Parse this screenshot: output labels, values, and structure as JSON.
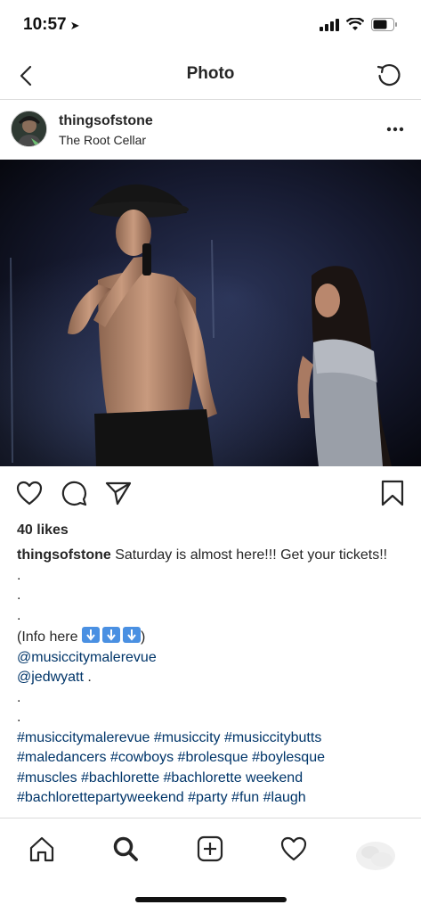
{
  "status_bar": {
    "time": "10:57"
  },
  "nav": {
    "title": "Photo"
  },
  "post": {
    "username": "thingsofstone",
    "location": "The Root Cellar",
    "likes": "40 likes",
    "caption": {
      "username": "thingsofstone",
      "text": "Saturday is almost here!!! Get your tickets!!",
      "dot1": ".",
      "dot2": ".",
      "dot3": ".",
      "info_prefix": "(Info here",
      "info_suffix": ")",
      "mention1": "@musiccitymalerevue",
      "mention2": "@jedwyatt",
      "mention2_suffix": " .",
      "dot4": ".",
      "dot5": ".",
      "hashtags_line1": "#musiccitymalerevue #musiccity #musiccitybutts",
      "hashtags_line2": "#maledancers #cowboys #brolesque #boylesque",
      "hashtags_line3": "#muscles #bachlorette #bachlorette weekend",
      "hashtags_line4": "#bachlorettepartyweekend #party #fun #laugh"
    }
  },
  "colors": {
    "text": "#262626",
    "link": "#003569",
    "divider": "#dbdbdb",
    "emoji_arrow_bg": "#4a90e2"
  },
  "icons": {
    "back": "chevron-left-icon",
    "refresh": "refresh-icon",
    "more": "more-dots-icon",
    "like": "heart-icon",
    "comment": "comment-icon",
    "share": "send-icon",
    "save": "bookmark-icon",
    "home": "home-icon",
    "search": "search-icon",
    "add": "add-post-icon",
    "activity": "heart-icon",
    "profile": "profile-icon"
  }
}
